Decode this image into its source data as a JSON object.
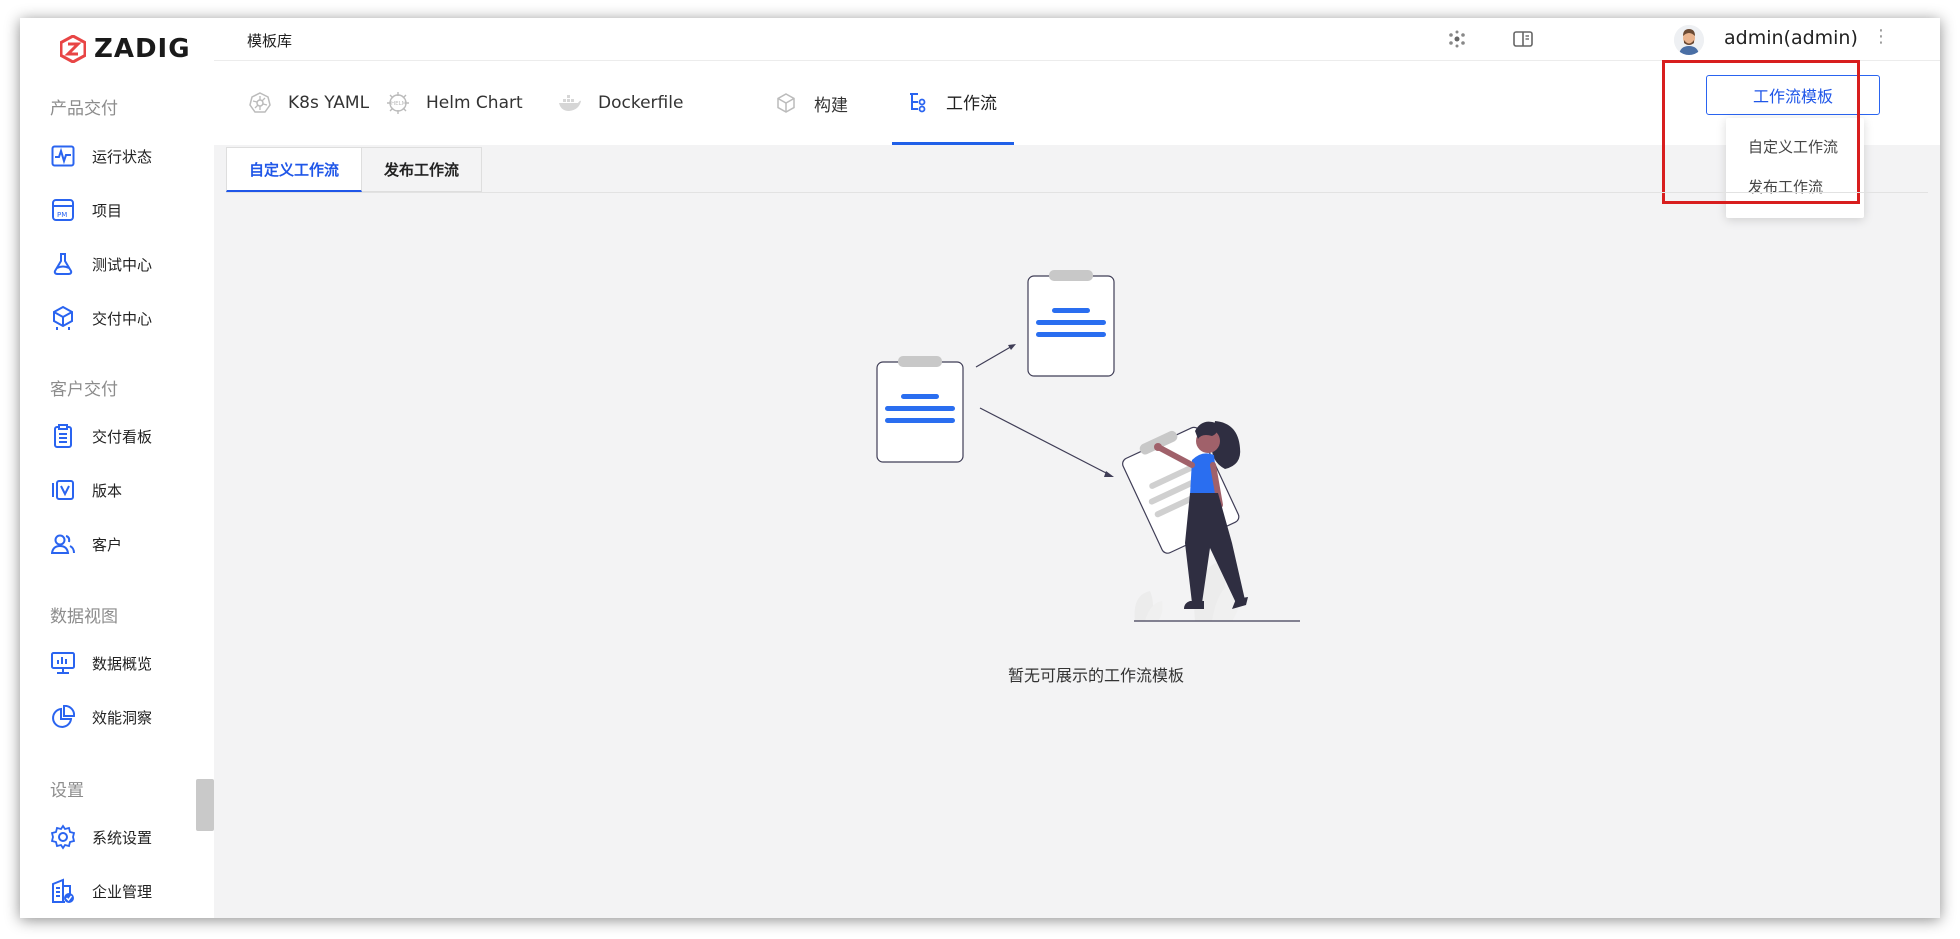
{
  "app": {
    "logo_text": "ZADIG",
    "brand_color": "#e84545",
    "accent": "#1f56e8"
  },
  "sidebar": {
    "sections": [
      {
        "title": "产品交付"
      },
      {
        "title": "客户交付"
      },
      {
        "title": "数据视图"
      },
      {
        "title": "设置"
      }
    ],
    "items": [
      {
        "label": "运行状态",
        "icon": "activity-monitor-icon"
      },
      {
        "label": "项目",
        "icon": "project-pm-icon"
      },
      {
        "label": "测试中心",
        "icon": "flask-icon"
      },
      {
        "label": "交付中心",
        "icon": "package-icon"
      },
      {
        "label": "交付看板",
        "icon": "clipboard-icon"
      },
      {
        "label": "版本",
        "icon": "version-icon"
      },
      {
        "label": "客户",
        "icon": "users-icon"
      },
      {
        "label": "数据概览",
        "icon": "monitor-chart-icon"
      },
      {
        "label": "效能洞察",
        "icon": "pie-chart-icon"
      },
      {
        "label": "系统设置",
        "icon": "gear-icon"
      },
      {
        "label": "企业管理",
        "icon": "building-icon"
      }
    ]
  },
  "topbar": {
    "title": "模板库",
    "username": "admin(admin)",
    "more": "⋮"
  },
  "tabs": [
    {
      "label": "K8s YAML",
      "icon": "kubernetes-icon"
    },
    {
      "label": "Helm Chart",
      "icon": "helm-icon"
    },
    {
      "label": "Dockerfile",
      "icon": "docker-icon"
    },
    {
      "label": "构建",
      "icon": "cube-icon"
    },
    {
      "label": "工作流",
      "icon": "workflow-icon",
      "active": true
    }
  ],
  "template_button": {
    "label": "工作流模板"
  },
  "dropdown": {
    "items": [
      {
        "label": "自定义工作流"
      },
      {
        "label": "发布工作流"
      }
    ]
  },
  "subtabs": [
    {
      "label": "自定义工作流",
      "active": true
    },
    {
      "label": "发布工作流"
    }
  ],
  "empty_state": {
    "text": "暂无可展示的工作流模板"
  }
}
